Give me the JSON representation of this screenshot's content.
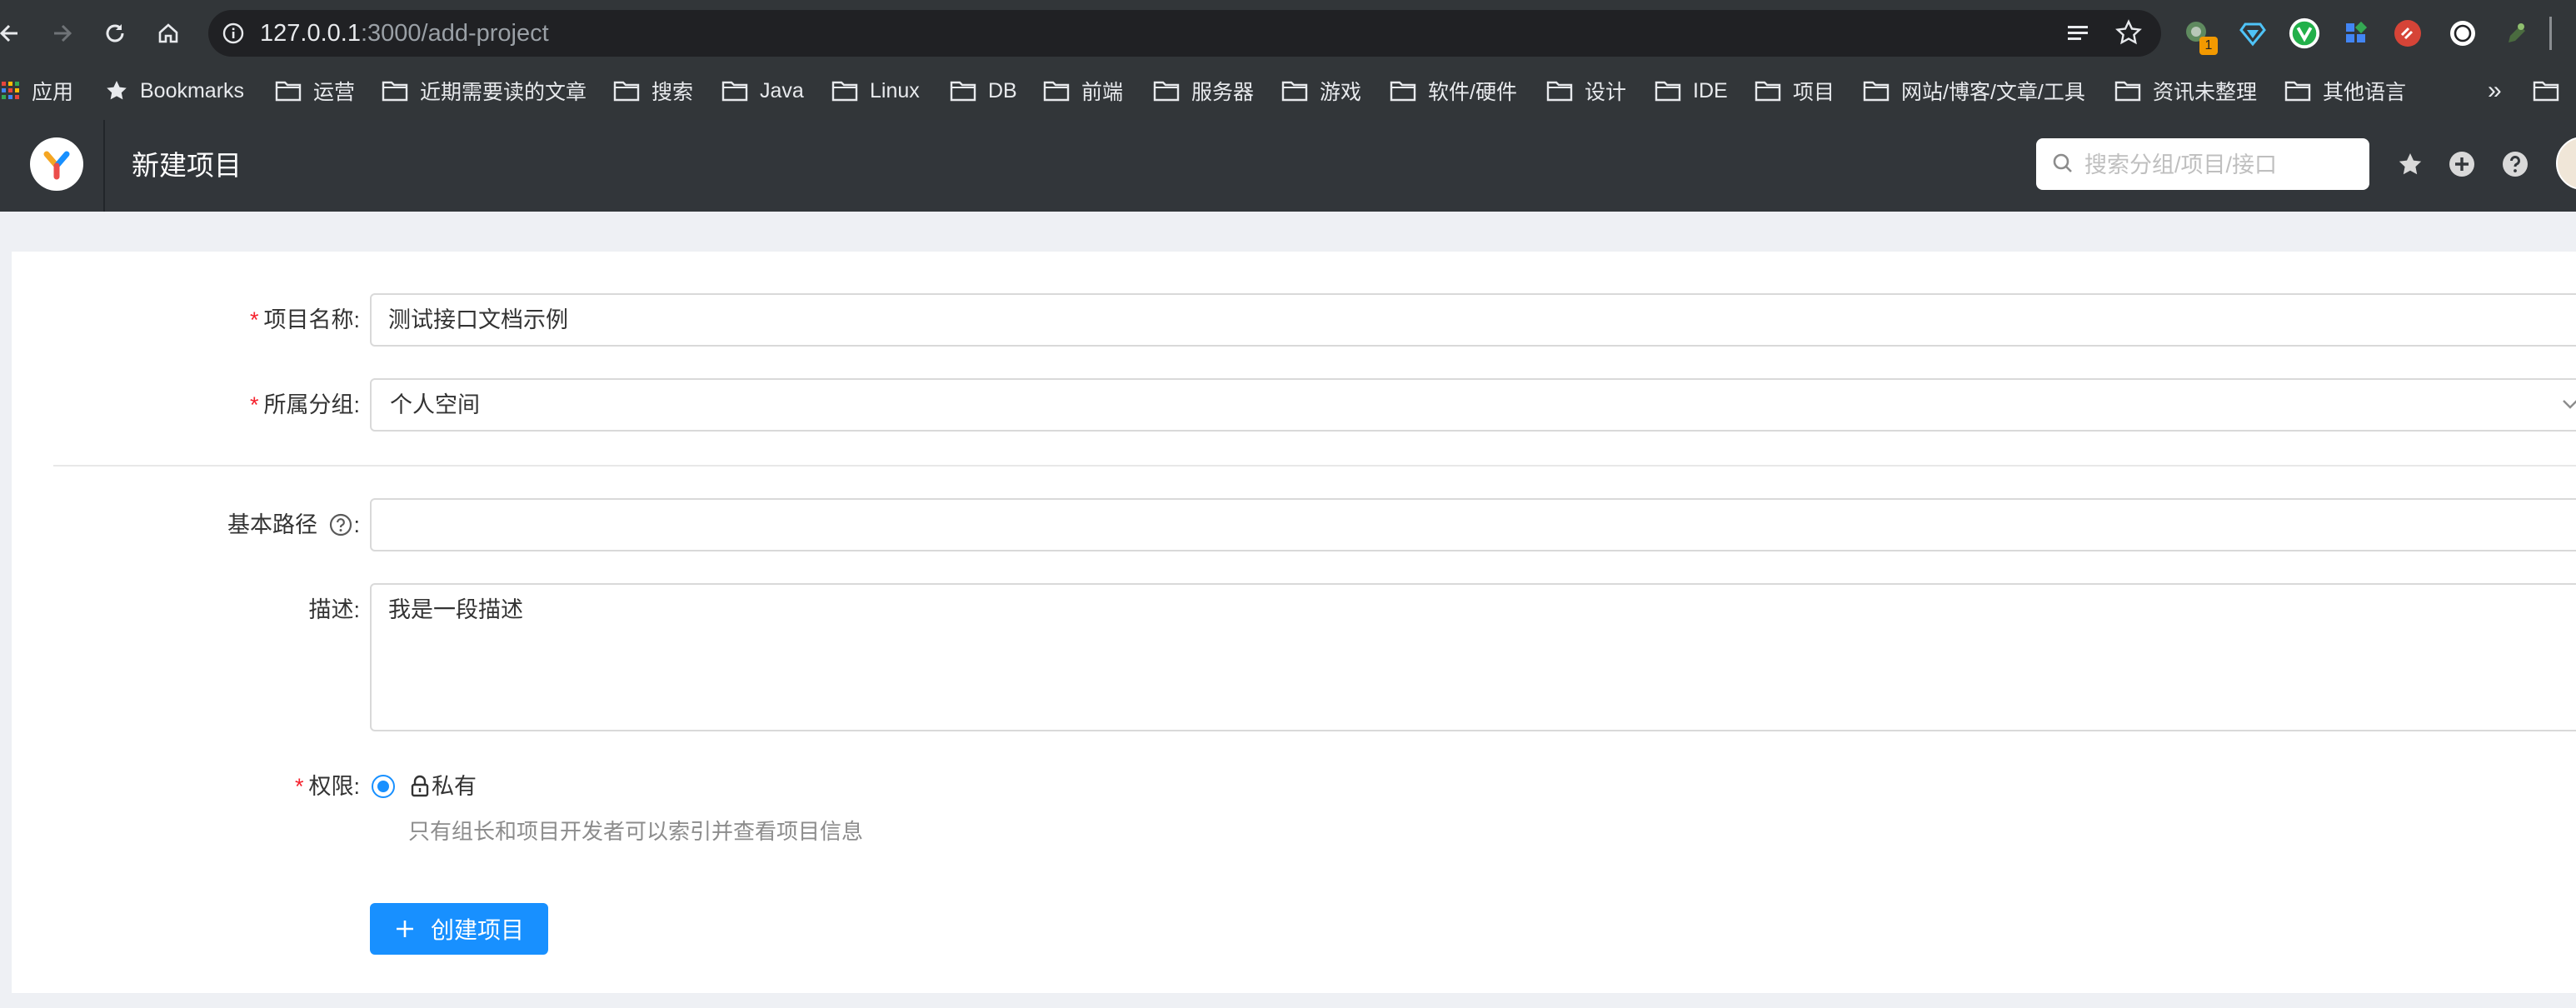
{
  "browser": {
    "url_host": "127.0.0.1",
    "url_path": ":3000/add-project",
    "bookmarks": [
      {
        "label": "应用",
        "icon": "apps-grid-icon"
      },
      {
        "label": "Bookmarks",
        "icon": "star-icon"
      },
      {
        "label": "运营",
        "icon": "folder-icon"
      },
      {
        "label": "近期需要读的文章",
        "icon": "folder-icon"
      },
      {
        "label": "搜索",
        "icon": "folder-icon"
      },
      {
        "label": "Java",
        "icon": "folder-icon"
      },
      {
        "label": "Linux",
        "icon": "folder-icon"
      },
      {
        "label": "DB",
        "icon": "folder-icon"
      },
      {
        "label": "前端",
        "icon": "folder-icon"
      },
      {
        "label": "服务器",
        "icon": "folder-icon"
      },
      {
        "label": "游戏",
        "icon": "folder-icon"
      },
      {
        "label": "软件/硬件",
        "icon": "folder-icon"
      },
      {
        "label": "设计",
        "icon": "folder-icon"
      },
      {
        "label": "IDE",
        "icon": "folder-icon"
      },
      {
        "label": "项目",
        "icon": "folder-icon"
      },
      {
        "label": "网站/博客/文章/工具",
        "icon": "folder-icon"
      },
      {
        "label": "资讯未整理",
        "icon": "folder-icon"
      },
      {
        "label": "其他语言",
        "icon": "folder-icon"
      }
    ],
    "bookmarks_overflow": "»",
    "extension_badge": "1"
  },
  "header": {
    "title": "新建项目",
    "search_placeholder": "搜索分组/项目/接口"
  },
  "form": {
    "name": {
      "required_mark": "*",
      "label": "项目名称",
      "colon": ":",
      "value": "测试接口文档示例"
    },
    "group": {
      "required_mark": "*",
      "label": "所属分组",
      "colon": ":",
      "value": "个人空间"
    },
    "basepath": {
      "label": "基本路径",
      "colon": ":",
      "value": ""
    },
    "desc": {
      "label": "描述",
      "colon": ":",
      "value": "我是一段描述"
    },
    "permission": {
      "required_mark": "*",
      "label": "权限",
      "colon": ":",
      "option": "私有",
      "hint": "只有组长和项目开发者可以索引并查看项目信息"
    },
    "submit_label": "创建项目"
  },
  "colors": {
    "primary": "#1890ff",
    "required": "#f5222d",
    "header_bg": "#32363a",
    "chrome_bg": "#323639"
  }
}
